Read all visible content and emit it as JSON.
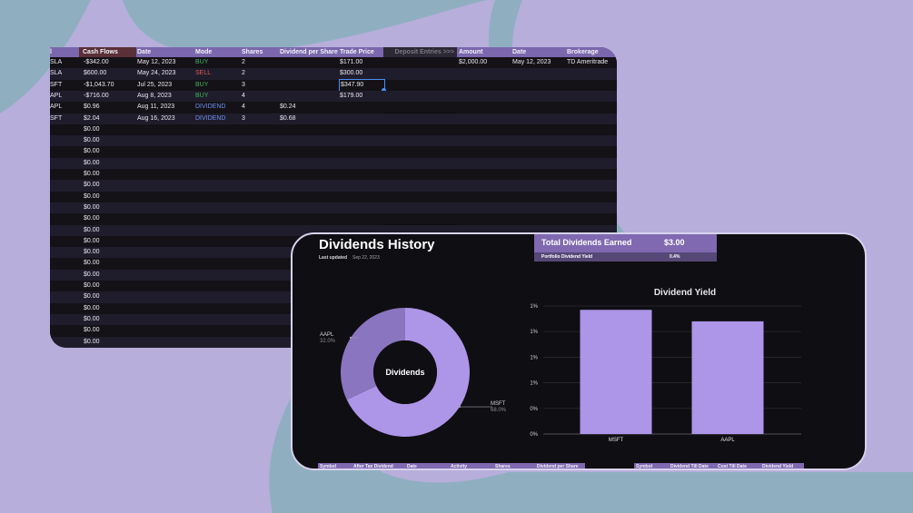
{
  "sheet": {
    "headers": {
      "symbol": "l",
      "cash_flows": "Cash Flows",
      "date": "Date",
      "mode": "Mode",
      "shares": "Shares",
      "dividend_per_share": "Dividend per Share",
      "trade_price": "Trade Price",
      "deposit_entries": "Deposit Entries >>>",
      "amount": "Amount",
      "deposit_date": "Date",
      "brokerage": "Brokerage"
    },
    "rows": [
      {
        "symbol": "SLA",
        "cash": "-$342.00",
        "date": "May 12, 2023",
        "mode": "BUY",
        "shares": "2",
        "dps": "",
        "price": "$171.00"
      },
      {
        "symbol": "SLA",
        "cash": "$600.00",
        "date": "May 24, 2023",
        "mode": "SELL",
        "shares": "2",
        "dps": "",
        "price": "$300.00"
      },
      {
        "symbol": "SFT",
        "cash": "-$1,043.70",
        "date": "Jul 25, 2023",
        "mode": "BUY",
        "shares": "3",
        "dps": "",
        "price": "$347.90"
      },
      {
        "symbol": "APL",
        "cash": "-$716.00",
        "date": "Aug 8, 2023",
        "mode": "BUY",
        "shares": "4",
        "dps": "",
        "price": "$179.00"
      },
      {
        "symbol": "APL",
        "cash": "$0.96",
        "date": "Aug 11, 2023",
        "mode": "DIVIDEND",
        "shares": "4",
        "dps": "$0.24",
        "price": ""
      },
      {
        "symbol": "SFT",
        "cash": "$2.04",
        "date": "Aug 16, 2023",
        "mode": "DIVIDEND",
        "shares": "3",
        "dps": "$0.68",
        "price": ""
      }
    ],
    "empty_cash": "$0.00",
    "deposit_rows": [
      {
        "amount": "$2,000.00",
        "date": "May 12, 2023",
        "brokerage": "TD Ameritrade"
      }
    ]
  },
  "dashboard": {
    "title": "Dividends History",
    "last_updated_label": "Last updated",
    "last_updated_value": "Sep 22, 2023",
    "total_label": "Total Dividends Earned",
    "total_value": "$3.00",
    "yield_label": "Portfolio Dividend Yield",
    "yield_value": "0.4%",
    "bottom_left_headers": [
      "Symbol",
      "After Tax Dividend",
      "Date",
      "Activity",
      "Shares",
      "Dividend per Share"
    ],
    "bottom_right_headers": [
      "Symbol",
      "Dividend Till Date",
      "Cost Till Date",
      "Dividend Yield"
    ]
  },
  "chart_data": [
    {
      "type": "pie",
      "title": "",
      "center_label": "Dividends",
      "slices": [
        {
          "label": "MSFT",
          "value": 68.0,
          "display": "68.0%",
          "color": "#ad95e8"
        },
        {
          "label": "AAPL",
          "value": 32.0,
          "display": "32.0%",
          "color": "#8a75c0"
        }
      ]
    },
    {
      "type": "bar",
      "title": "Dividend Yield",
      "categories": [
        "MSFT",
        "AAPL"
      ],
      "values": [
        0.0097,
        0.0088
      ],
      "color": "#ad95e8",
      "yticks": [
        "0%",
        "0%",
        "1%",
        "1%",
        "1%",
        "1%"
      ],
      "ylim": [
        0,
        0.01
      ],
      "grid": true
    }
  ],
  "colors": {
    "background": "#b7aedb",
    "blob": "#8fafc1",
    "header": "#7a67ad",
    "accent": "#8069b0"
  }
}
